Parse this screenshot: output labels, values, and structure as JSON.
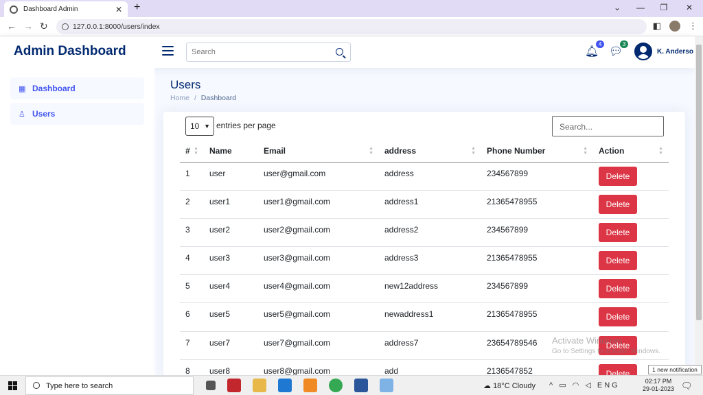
{
  "browser": {
    "tab_title": "Dashboard Admin",
    "url": "127.0.0.1:8000/users/index"
  },
  "header": {
    "brand": "Admin Dashboard",
    "search_placeholder": "Search",
    "notifications_count": "4",
    "messages_count": "3",
    "user_name": "K. Anderso"
  },
  "sidebar": {
    "items": [
      {
        "label": "Dashboard",
        "icon": "grid-icon"
      },
      {
        "label": "Users",
        "icon": "person-icon"
      }
    ]
  },
  "page": {
    "title": "Users",
    "breadcrumb": [
      "Home",
      "/",
      "Dashboard"
    ]
  },
  "table_controls": {
    "entries_value": "10",
    "entries_label": "entries per page",
    "search_placeholder": "Search..."
  },
  "table": {
    "headers": [
      "#",
      "Name",
      "Email",
      "address",
      "Phone Number",
      "Action"
    ],
    "rows": [
      [
        "1",
        "user",
        "user@gmail.com",
        "address",
        "234567899",
        "Delete"
      ],
      [
        "2",
        "user1",
        "user1@gmail.com",
        "address1",
        "21365478955",
        "Delete"
      ],
      [
        "3",
        "user2",
        "user2@gmail.com",
        "address2",
        "234567899",
        "Delete"
      ],
      [
        "4",
        "user3",
        "user3@gmail.com",
        "address3",
        "21365478955",
        "Delete"
      ],
      [
        "5",
        "user4",
        "user4@gmail.com",
        "new12address",
        "234567899",
        "Delete"
      ],
      [
        "6",
        "user5",
        "user5@gmail.com",
        "newaddress1",
        "21365478955",
        "Delete"
      ],
      [
        "7",
        "user7",
        "user7@gmail.com",
        "address7",
        "23654789546",
        "Delete"
      ],
      [
        "8",
        "user8",
        "user8@gmail.com",
        "add",
        "2136547852",
        "Delete"
      ]
    ]
  },
  "watermark": {
    "line1": "Activate Windows",
    "line2": "Go to Settings to activate Windows."
  },
  "taskbar": {
    "search_placeholder": "Type here to search",
    "weather": "18°C  Cloudy",
    "lang": "ENG",
    "time": "02:17 PM",
    "date": "29-01-2023",
    "notification_tip": "1 new notification"
  }
}
